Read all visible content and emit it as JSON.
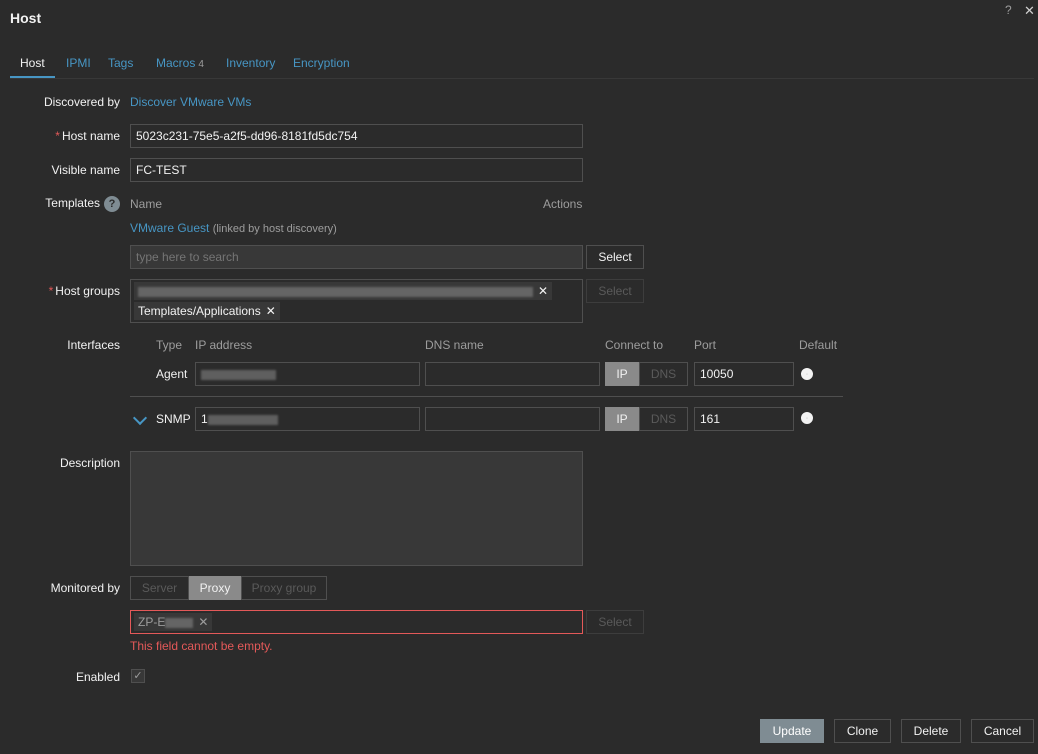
{
  "dialog": {
    "title": "Host",
    "help_icon": "?",
    "close_icon": "✕"
  },
  "tabs": [
    {
      "label": "Host"
    },
    {
      "label": "IPMI"
    },
    {
      "label": "Tags"
    },
    {
      "label": "Macros",
      "count": "4"
    },
    {
      "label": "Inventory"
    },
    {
      "label": "Encryption"
    }
  ],
  "discovered": {
    "label": "Discovered by",
    "value": "Discover VMware VMs"
  },
  "host_name": {
    "label": "Host name",
    "value": "5023c231-75e5-a2f5-dd96-8181fd5dc754"
  },
  "visible_name": {
    "label": "Visible name",
    "value": "FC-TEST"
  },
  "templates": {
    "label": "Templates",
    "col_name": "Name",
    "col_actions": "Actions",
    "linked_name": "VMware Guest",
    "linked_note": "(linked by host discovery)",
    "search_placeholder": "type here to search",
    "select_label": "Select"
  },
  "host_groups": {
    "label": "Host groups",
    "chip_label": "Templates/Applications",
    "select_label": "Select"
  },
  "interfaces": {
    "label": "Interfaces",
    "columns": {
      "type": "Type",
      "ip": "IP address",
      "dns": "DNS name",
      "connect": "Connect to",
      "port": "Port",
      "default": "Default"
    },
    "agent": {
      "type": "Agent",
      "ip_btn": "IP",
      "dns_btn": "DNS",
      "port": "10050"
    },
    "snmp": {
      "type": "SNMP",
      "ip_prefix": "1",
      "ip_btn": "IP",
      "dns_btn": "DNS",
      "port": "161"
    }
  },
  "description": {
    "label": "Description"
  },
  "monitored_by": {
    "label": "Monitored by",
    "options": [
      "Server",
      "Proxy",
      "Proxy group"
    ],
    "proxy_chip": "ZP-E",
    "select_label": "Select",
    "error": "This field cannot be empty."
  },
  "enabled": {
    "label": "Enabled",
    "check": "✓"
  },
  "footer": {
    "update": "Update",
    "clone": "Clone",
    "delete": "Delete",
    "cancel": "Cancel"
  }
}
